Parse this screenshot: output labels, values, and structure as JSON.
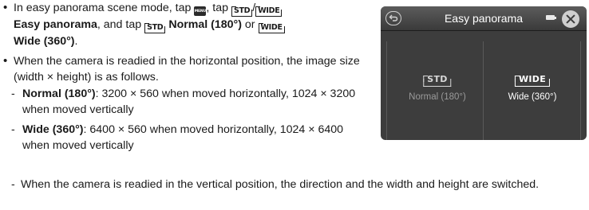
{
  "instructions": {
    "b1_pre": "In easy panorama scene mode, tap",
    "b1_mid1": ", tap",
    "b1_slash": "/",
    "b1_line2_name": "Easy panorama",
    "b1_line2_mid": ", and tap",
    "b1_normal": "Normal (180°)",
    "b1_or": "or",
    "b1_wide": "Wide (360°)",
    "b1_end": ".",
    "b2_text": "When the camera is readied in the horizontal position, the image size (width × height) is as follows.",
    "sub1_label": "Normal (180°)",
    "sub1_text": ": 3200 × 560 when moved horizontally, 1024 × 3200 when moved vertically",
    "sub2_label": "Wide (360°)",
    "sub2_text": ": 6400 × 560 when moved horizontally, 1024 × 6400 when moved vertically",
    "note_text": "When the camera is readied in the vertical position, the direction and the width and height are switched."
  },
  "glyphs": {
    "menu": "MENU",
    "std": "STD",
    "wide": "WIDE"
  },
  "camera_screen": {
    "title": "Easy panorama",
    "options": [
      {
        "glyph": "STD",
        "label": "Normal (180°)"
      },
      {
        "glyph": "WIDE",
        "label": "Wide (360°)"
      }
    ]
  },
  "colors": {
    "screen_bg": "#3d3d3d",
    "selected_text": "#ffffff",
    "unselected_text": "#9a9a9a"
  }
}
